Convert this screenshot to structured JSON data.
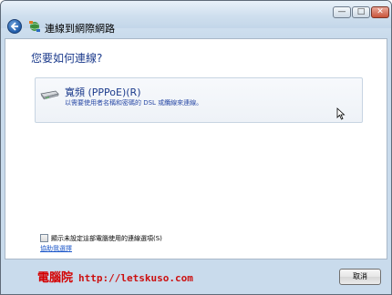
{
  "window": {
    "title": "連線到網際網路",
    "controls": {
      "minimize": "—",
      "maximize": "□",
      "close": "✕"
    }
  },
  "main": {
    "heading": "您要如何連線?",
    "option": {
      "title": "寬頻 (PPPoE)(R)",
      "description": "以需要使用者名稱和密碼的 DSL 或纜線來連線。",
      "icon": "modem-icon"
    },
    "checkbox": {
      "label": "顯示未設定這部電腦使用的連線選項(S)",
      "checked": false
    },
    "help_link": "協助我選擇"
  },
  "footer": {
    "watermark_name": "電腦院",
    "watermark_url": "http://letskuso.com",
    "cancel_label": "取消"
  },
  "colors": {
    "accent_text": "#1c3b8c",
    "link": "#1b56c9",
    "watermark": "#d40000"
  }
}
